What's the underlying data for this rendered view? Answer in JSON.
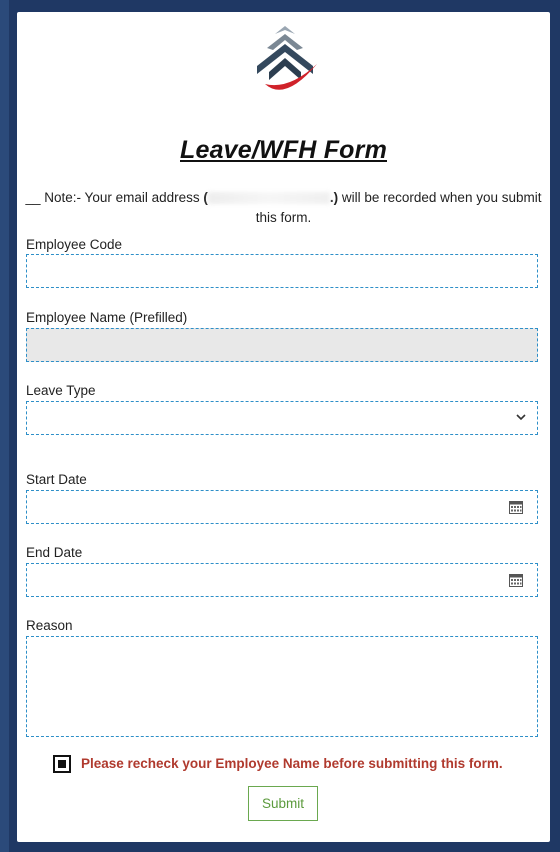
{
  "form": {
    "title": "Leave/WFH Form",
    "note_prefix": "__ Note:- Your email address ",
    "note_email_open": "(",
    "note_email_close": ".)",
    "note_suffix": " will be recorded when you submit this form."
  },
  "fields": {
    "employee_code": {
      "label": "Employee Code",
      "value": ""
    },
    "employee_name": {
      "label": "Employee Name (Prefilled)",
      "value": ""
    },
    "leave_type": {
      "label": "Leave Type",
      "value": ""
    },
    "start_date": {
      "label": "Start Date",
      "value": ""
    },
    "end_date": {
      "label": "End Date",
      "value": ""
    },
    "reason": {
      "label": "Reason",
      "value": ""
    }
  },
  "confirm": {
    "text": "Please recheck your Employee Name before submitting this form.",
    "checked": true
  },
  "submit": {
    "label": "Submit"
  },
  "colors": {
    "frame": "#1f3864",
    "field_border": "#2e8fc8",
    "warning_text": "#b03a2e",
    "submit_green": "#5b9a3c"
  },
  "icons": {
    "logo": "company-logo",
    "dropdown": "chevron-down-icon",
    "calendar": "calendar-icon"
  }
}
